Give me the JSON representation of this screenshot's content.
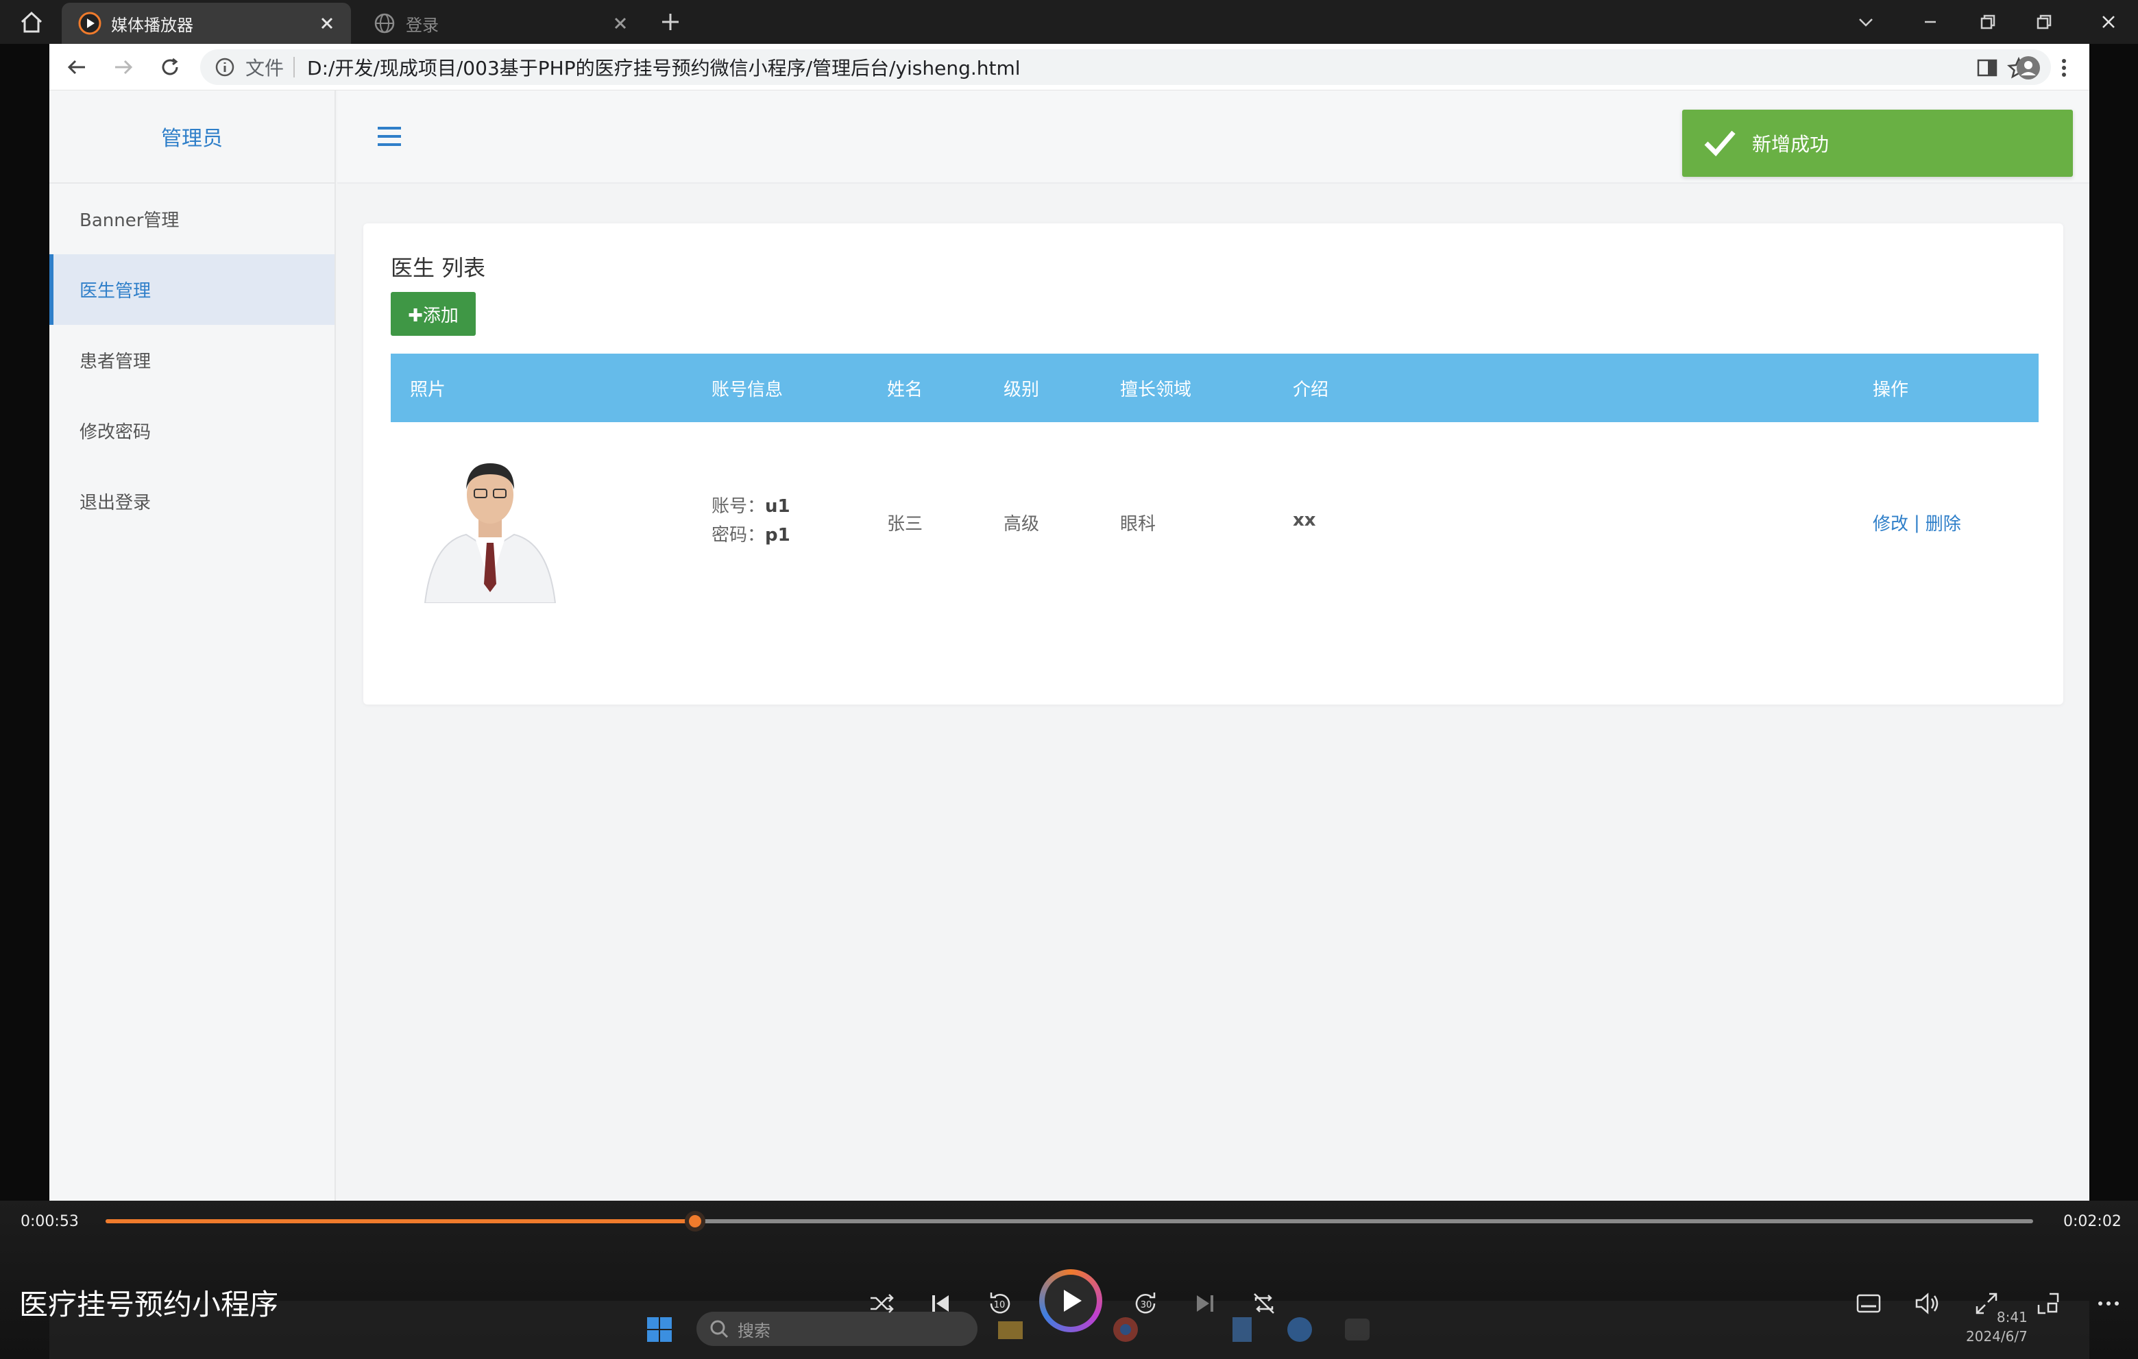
{
  "window": {
    "tabs": [
      {
        "label": "媒体播放器",
        "active": true
      },
      {
        "label": "登录",
        "active": false
      }
    ]
  },
  "browser": {
    "file_label": "文件",
    "url": "D:/开发/现成项目/003基于PHP的医疗挂号预约微信小程序/管理后台/yisheng.html"
  },
  "sidebar": {
    "brand": "管理员",
    "items": [
      {
        "label": "Banner管理",
        "active": false
      },
      {
        "label": "医生管理",
        "active": true
      },
      {
        "label": "患者管理",
        "active": false
      },
      {
        "label": "修改密码",
        "active": false
      },
      {
        "label": "退出登录",
        "active": false
      }
    ]
  },
  "toast": {
    "message": "新增成功"
  },
  "doctor_list": {
    "title": "医生 列表",
    "add_label": "✚添加",
    "columns": [
      "照片",
      "账号信息",
      "姓名",
      "级别",
      "擅长领域",
      "介绍",
      "操作"
    ],
    "rows": [
      {
        "account": "u1",
        "password": "p1",
        "account_prefix": "账号：",
        "password_prefix": "密码：",
        "name": "张三",
        "level": "高级",
        "specialty": "眼科",
        "intro": "xx",
        "edit_label": "修改",
        "divider": "|",
        "delete_label": "删除"
      }
    ]
  },
  "player": {
    "elapsed": "0:00:53",
    "duration": "0:02:02",
    "progress": 0.306,
    "video_title": "医疗挂号预约小程序"
  },
  "taskbar": {
    "search_placeholder": "搜索",
    "time": "8:41",
    "date": "2024/6/7"
  },
  "colors": {
    "accent": "#2f7fc9",
    "table_header": "#65bbea",
    "add_button": "#3f9745",
    "toast": "#69b044",
    "progress": "#f07b2c"
  }
}
